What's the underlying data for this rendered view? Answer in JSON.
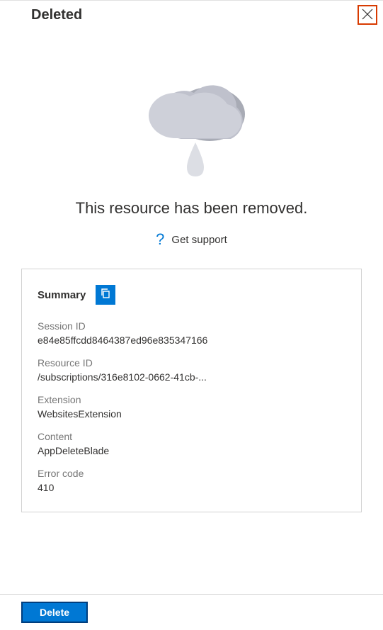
{
  "header": {
    "title": "Deleted"
  },
  "message": "This resource has been removed.",
  "support": {
    "label": "Get support"
  },
  "summary": {
    "title": "Summary",
    "fields": {
      "sessionId": {
        "label": "Session ID",
        "value": "e84e85ffcdd8464387ed96e835347166"
      },
      "resourceId": {
        "label": "Resource ID",
        "value": "/subscriptions/316e8102-0662-41cb-..."
      },
      "extension": {
        "label": "Extension",
        "value": "WebsitesExtension"
      },
      "content": {
        "label": "Content",
        "value": "AppDeleteBlade"
      },
      "errorCode": {
        "label": "Error code",
        "value": "410"
      }
    }
  },
  "footer": {
    "deleteLabel": "Delete"
  }
}
